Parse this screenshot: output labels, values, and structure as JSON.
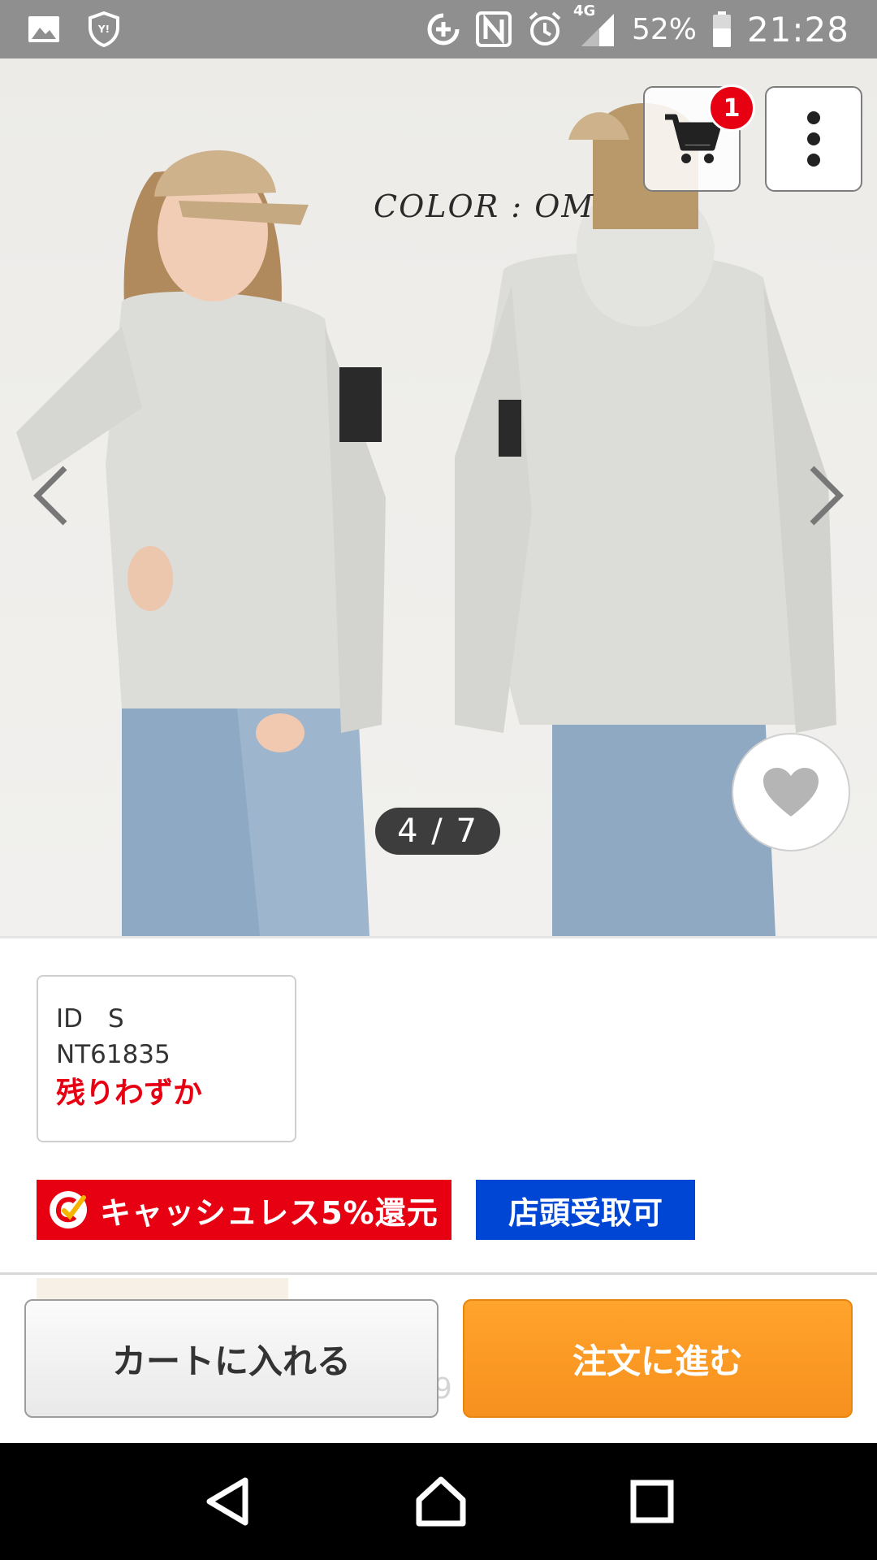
{
  "status_bar": {
    "battery_percent": "52%",
    "network": "4G",
    "time": "21:28",
    "left_icons": [
      "gallery-icon",
      "shield-icon"
    ],
    "right_icons": [
      "data-saver-icon",
      "nfc-icon",
      "alarm-icon",
      "signal-icon",
      "battery-icon"
    ]
  },
  "gallery": {
    "color_label": "COLOR : OM",
    "pager": "4 / 7",
    "cart_badge_count": "1"
  },
  "variant": {
    "size_line": "ID　S",
    "code": "NT61835",
    "stock_status": "残りわずか"
  },
  "badges": {
    "cashless": "キャッシュレス5%還元",
    "store_pickup": "店頭受取可"
  },
  "actions": {
    "add_to_cart": "カートに入れる",
    "proceed_order": "注文に進む",
    "partially_hidden_text": "9"
  },
  "colors": {
    "status_bar": "#8f8f8f",
    "stock_red": "#e60012",
    "cashless_red": "#e60012",
    "store_blue": "#0046d5",
    "order_orange": "#f7901e"
  }
}
